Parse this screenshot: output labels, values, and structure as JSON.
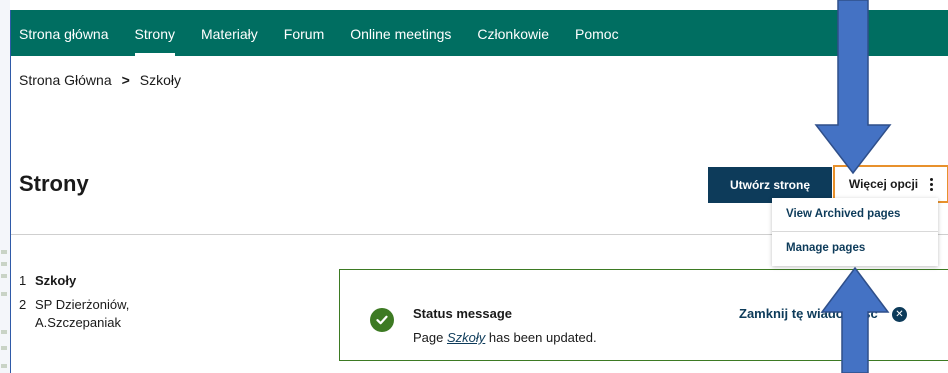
{
  "nav": {
    "items": [
      {
        "label": "Strona główna"
      },
      {
        "label": "Strony",
        "active": true
      },
      {
        "label": "Materiały"
      },
      {
        "label": "Forum"
      },
      {
        "label": "Online meetings"
      },
      {
        "label": "Członkowie"
      },
      {
        "label": "Pomoc"
      }
    ]
  },
  "breadcrumb": {
    "home": "Strona Główna",
    "separator": ">",
    "current": "Szkoły"
  },
  "header": {
    "title": "Strony",
    "create_button": "Utwórz stronę",
    "more_button": "Więcej opcji"
  },
  "dropdown": {
    "items": [
      "View Archived pages",
      "Manage pages"
    ]
  },
  "tree": {
    "items": [
      {
        "num": "1",
        "label": "Szkoły"
      },
      {
        "num": "2",
        "label": "SP Dzierżoniów, A.Szczepaniak"
      }
    ]
  },
  "status": {
    "title": "Status message",
    "prefix": "Page ",
    "page_name": "Szkoły",
    "suffix": " has been updated.",
    "close_label": "Zamknij tę wiadomość",
    "close_icon": "close-icon"
  },
  "colors": {
    "nav_bg": "#006e61",
    "primary": "#0d3b5a",
    "accent_border": "#e8912c",
    "success": "#3d7a23",
    "arrow": "#4472c4"
  }
}
